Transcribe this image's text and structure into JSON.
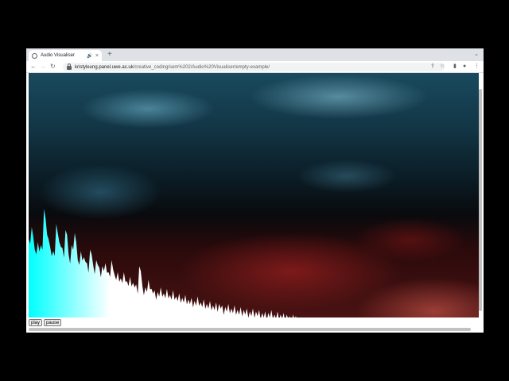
{
  "tab": {
    "title": "Audio Visualiser",
    "audio_icon": "speaker-icon",
    "close": "×"
  },
  "new_tab": "+",
  "tab_menu": "⌄",
  "nav": {
    "back": "←",
    "forward": "→",
    "reload": "↻"
  },
  "address": {
    "host": "kristyleung.panel.uwe.ac.uk",
    "path": "/creative_coding/sem%202/Audio%20Visualiser/empty-example/"
  },
  "toolbar_icons": {
    "share": "⇪",
    "star": "☆",
    "sidebar": "▮",
    "profile": "●",
    "menu": "⋮"
  },
  "controls": {
    "play_label": "play",
    "pause_label": "pause"
  },
  "colors": {
    "bars_left": "#00ffff",
    "bars_right": "#ffffff"
  },
  "spectrum": {
    "levels": [
      0.52,
      0.6,
      0.45,
      0.5,
      0.48,
      0.72,
      0.55,
      0.47,
      0.44,
      0.62,
      0.5,
      0.46,
      0.58,
      0.42,
      0.48,
      0.56,
      0.38,
      0.44,
      0.4,
      0.36,
      0.45,
      0.35,
      0.38,
      0.33,
      0.34,
      0.36,
      0.3,
      0.38,
      0.28,
      0.3,
      0.26,
      0.3,
      0.24,
      0.27,
      0.23,
      0.22,
      0.34,
      0.21,
      0.2,
      0.25,
      0.19,
      0.18,
      0.17,
      0.2,
      0.16,
      0.19,
      0.15,
      0.18,
      0.14,
      0.16,
      0.13,
      0.15,
      0.12,
      0.13,
      0.11,
      0.14,
      0.1,
      0.12,
      0.09,
      0.11,
      0.08,
      0.1,
      0.09,
      0.08,
      0.07,
      0.09,
      0.06,
      0.08,
      0.05,
      0.07,
      0.05,
      0.06,
      0.04,
      0.06,
      0.04,
      0.05,
      0.03,
      0.04,
      0.03,
      0.05,
      0.02,
      0.04,
      0.02,
      0.03,
      0.02,
      0.01,
      0.02,
      0.01
    ]
  }
}
